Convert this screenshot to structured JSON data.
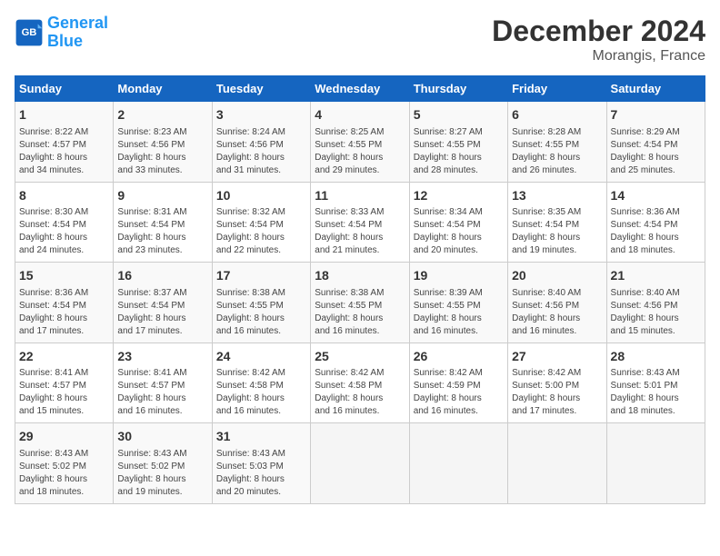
{
  "header": {
    "logo_line1": "General",
    "logo_line2": "Blue",
    "title": "December 2024",
    "subtitle": "Morangis, France"
  },
  "columns": [
    "Sunday",
    "Monday",
    "Tuesday",
    "Wednesday",
    "Thursday",
    "Friday",
    "Saturday"
  ],
  "weeks": [
    [
      {
        "day": "1",
        "info": "Sunrise: 8:22 AM\nSunset: 4:57 PM\nDaylight: 8 hours\nand 34 minutes."
      },
      {
        "day": "2",
        "info": "Sunrise: 8:23 AM\nSunset: 4:56 PM\nDaylight: 8 hours\nand 33 minutes."
      },
      {
        "day": "3",
        "info": "Sunrise: 8:24 AM\nSunset: 4:56 PM\nDaylight: 8 hours\nand 31 minutes."
      },
      {
        "day": "4",
        "info": "Sunrise: 8:25 AM\nSunset: 4:55 PM\nDaylight: 8 hours\nand 29 minutes."
      },
      {
        "day": "5",
        "info": "Sunrise: 8:27 AM\nSunset: 4:55 PM\nDaylight: 8 hours\nand 28 minutes."
      },
      {
        "day": "6",
        "info": "Sunrise: 8:28 AM\nSunset: 4:55 PM\nDaylight: 8 hours\nand 26 minutes."
      },
      {
        "day": "7",
        "info": "Sunrise: 8:29 AM\nSunset: 4:54 PM\nDaylight: 8 hours\nand 25 minutes."
      }
    ],
    [
      {
        "day": "8",
        "info": "Sunrise: 8:30 AM\nSunset: 4:54 PM\nDaylight: 8 hours\nand 24 minutes."
      },
      {
        "day": "9",
        "info": "Sunrise: 8:31 AM\nSunset: 4:54 PM\nDaylight: 8 hours\nand 23 minutes."
      },
      {
        "day": "10",
        "info": "Sunrise: 8:32 AM\nSunset: 4:54 PM\nDaylight: 8 hours\nand 22 minutes."
      },
      {
        "day": "11",
        "info": "Sunrise: 8:33 AM\nSunset: 4:54 PM\nDaylight: 8 hours\nand 21 minutes."
      },
      {
        "day": "12",
        "info": "Sunrise: 8:34 AM\nSunset: 4:54 PM\nDaylight: 8 hours\nand 20 minutes."
      },
      {
        "day": "13",
        "info": "Sunrise: 8:35 AM\nSunset: 4:54 PM\nDaylight: 8 hours\nand 19 minutes."
      },
      {
        "day": "14",
        "info": "Sunrise: 8:36 AM\nSunset: 4:54 PM\nDaylight: 8 hours\nand 18 minutes."
      }
    ],
    [
      {
        "day": "15",
        "info": "Sunrise: 8:36 AM\nSunset: 4:54 PM\nDaylight: 8 hours\nand 17 minutes."
      },
      {
        "day": "16",
        "info": "Sunrise: 8:37 AM\nSunset: 4:54 PM\nDaylight: 8 hours\nand 17 minutes."
      },
      {
        "day": "17",
        "info": "Sunrise: 8:38 AM\nSunset: 4:55 PM\nDaylight: 8 hours\nand 16 minutes."
      },
      {
        "day": "18",
        "info": "Sunrise: 8:38 AM\nSunset: 4:55 PM\nDaylight: 8 hours\nand 16 minutes."
      },
      {
        "day": "19",
        "info": "Sunrise: 8:39 AM\nSunset: 4:55 PM\nDaylight: 8 hours\nand 16 minutes."
      },
      {
        "day": "20",
        "info": "Sunrise: 8:40 AM\nSunset: 4:56 PM\nDaylight: 8 hours\nand 16 minutes."
      },
      {
        "day": "21",
        "info": "Sunrise: 8:40 AM\nSunset: 4:56 PM\nDaylight: 8 hours\nand 15 minutes."
      }
    ],
    [
      {
        "day": "22",
        "info": "Sunrise: 8:41 AM\nSunset: 4:57 PM\nDaylight: 8 hours\nand 15 minutes."
      },
      {
        "day": "23",
        "info": "Sunrise: 8:41 AM\nSunset: 4:57 PM\nDaylight: 8 hours\nand 16 minutes."
      },
      {
        "day": "24",
        "info": "Sunrise: 8:42 AM\nSunset: 4:58 PM\nDaylight: 8 hours\nand 16 minutes."
      },
      {
        "day": "25",
        "info": "Sunrise: 8:42 AM\nSunset: 4:58 PM\nDaylight: 8 hours\nand 16 minutes."
      },
      {
        "day": "26",
        "info": "Sunrise: 8:42 AM\nSunset: 4:59 PM\nDaylight: 8 hours\nand 16 minutes."
      },
      {
        "day": "27",
        "info": "Sunrise: 8:42 AM\nSunset: 5:00 PM\nDaylight: 8 hours\nand 17 minutes."
      },
      {
        "day": "28",
        "info": "Sunrise: 8:43 AM\nSunset: 5:01 PM\nDaylight: 8 hours\nand 18 minutes."
      }
    ],
    [
      {
        "day": "29",
        "info": "Sunrise: 8:43 AM\nSunset: 5:02 PM\nDaylight: 8 hours\nand 18 minutes."
      },
      {
        "day": "30",
        "info": "Sunrise: 8:43 AM\nSunset: 5:02 PM\nDaylight: 8 hours\nand 19 minutes."
      },
      {
        "day": "31",
        "info": "Sunrise: 8:43 AM\nSunset: 5:03 PM\nDaylight: 8 hours\nand 20 minutes."
      },
      null,
      null,
      null,
      null
    ]
  ]
}
